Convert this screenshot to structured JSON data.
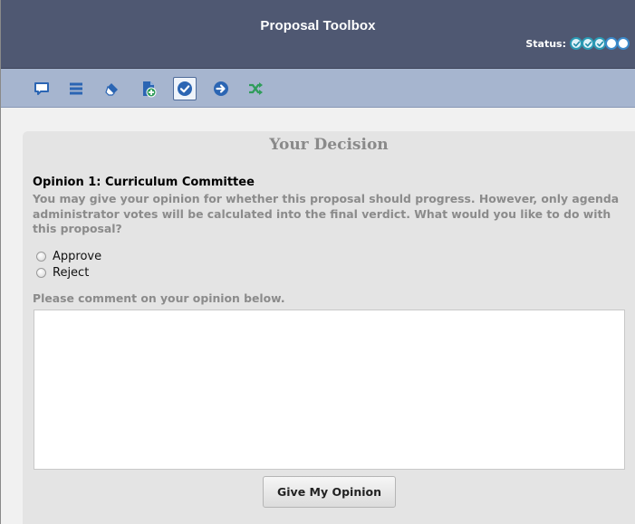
{
  "header": {
    "title": "Proposal Toolbox",
    "status_label": "Status:",
    "status_steps": [
      {
        "state": "done"
      },
      {
        "state": "done"
      },
      {
        "state": "done"
      },
      {
        "state": "pending"
      },
      {
        "state": "pending"
      }
    ]
  },
  "toolbar": {
    "tools": [
      {
        "icon": "comment-icon"
      },
      {
        "icon": "list-icon"
      },
      {
        "icon": "eraser-icon"
      },
      {
        "icon": "add-document-icon"
      },
      {
        "icon": "checkmark-icon",
        "active": true
      },
      {
        "icon": "arrow-right-circle-icon"
      },
      {
        "icon": "shuffle-icon"
      }
    ]
  },
  "decision": {
    "title": "Your Decision",
    "opinion_heading": "Opinion 1: Curriculum Committee",
    "instructions": "You may give your opinion for whether this proposal should progress. However, only agenda administrator votes will be calculated into the final verdict. What would you like to do with this proposal?",
    "options": [
      {
        "label": "Approve",
        "selected": false
      },
      {
        "label": "Reject",
        "selected": false
      }
    ],
    "comment_label": "Please comment on your opinion below.",
    "comment_value": "",
    "submit_label": "Give My Opinion"
  },
  "colors": {
    "header_bg": "#4f5872",
    "toolbar_bg": "#a6b5cf",
    "icon_blue": "#2b65b3",
    "icon_green": "#2f9c5a"
  }
}
